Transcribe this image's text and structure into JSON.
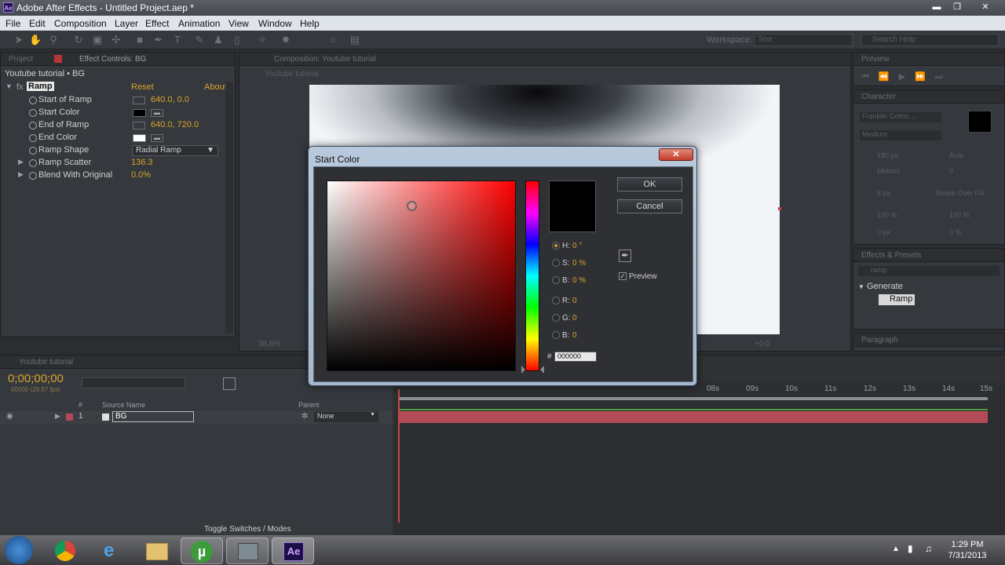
{
  "window": {
    "title": "Adobe After Effects - Untitled Project.aep *",
    "app_icon": "Ae"
  },
  "menu": [
    "File",
    "Edit",
    "Composition",
    "Layer",
    "Effect",
    "Animation",
    "View",
    "Window",
    "Help"
  ],
  "toolbar": {
    "workspace_label": "Workspace:",
    "workspace_value": "Text",
    "search_placeholder": "Search Help"
  },
  "effect_controls": {
    "tab_project": "Project",
    "tab_effect": "Effect Controls: BG",
    "breadcrumb": "Youtube tutorial • BG",
    "effect_name": "Ramp",
    "reset": "Reset",
    "about": "About...",
    "props": [
      {
        "label": "Start of Ramp",
        "value": "640.0, 0.0",
        "kind": "point"
      },
      {
        "label": "Start Color",
        "value": "",
        "kind": "color",
        "color": "#000000"
      },
      {
        "label": "End of Ramp",
        "value": "640.0, 720.0",
        "kind": "point"
      },
      {
        "label": "End Color",
        "value": "",
        "kind": "color",
        "color": "#ffffff"
      },
      {
        "label": "Ramp Shape",
        "value": "Radial Ramp",
        "kind": "select"
      },
      {
        "label": "Ramp Scatter",
        "value": "136.3",
        "kind": "number"
      },
      {
        "label": "Blend With Original",
        "value": "0.0%",
        "kind": "number"
      }
    ]
  },
  "composition": {
    "tab": "Composition: Youtube tutorial",
    "subtab": "Youtube tutorial",
    "zoom": "38.8%",
    "exposure": "+0.0"
  },
  "right_panels": {
    "preview_tab": "Preview",
    "character_tab": "Character",
    "font": "Franklin Gothic ...",
    "style": "Medium",
    "size": "180 px",
    "leading": "Auto",
    "kerning": "Metrics",
    "tracking": "0",
    "stroke": "Stroke Over Fill",
    "stroke_size": "5 px",
    "vscale": "100 %",
    "hscale": "100 %",
    "baseline": "0 px",
    "tsume": "0 %",
    "effects_tab": "Effects & Presets",
    "effects_search": "ramp",
    "category": "Generate",
    "effect_item": "Ramp",
    "paragraph_tab": "Paragraph"
  },
  "timeline": {
    "tab": "Youtube tutorial",
    "timecode": "0;00;00;00",
    "frames": "00000 (29.97 fps)",
    "col_num": "#",
    "col_source": "Source Name",
    "col_parent": "Parent",
    "layer_num": "1",
    "layer_name": "BG",
    "parent_value": "None",
    "footer": "Toggle Switches / Modes",
    "ruler": [
      "08s",
      "09s",
      "10s",
      "11s",
      "12s",
      "13s",
      "14s",
      "15s"
    ]
  },
  "dialog": {
    "title": "Start Color",
    "ok": "OK",
    "cancel": "Cancel",
    "preview": "Preview",
    "hsb": [
      {
        "label": "H:",
        "value": "0 °"
      },
      {
        "label": "S:",
        "value": "0 %"
      },
      {
        "label": "B:",
        "value": "0 %"
      }
    ],
    "rgb": [
      {
        "label": "R:",
        "value": "0"
      },
      {
        "label": "G:",
        "value": "0"
      },
      {
        "label": "B:",
        "value": "0"
      }
    ],
    "hex_prefix": "#",
    "hex": "000000",
    "current_color": "#000000",
    "accent": "#d7a52a"
  },
  "taskbar": {
    "time": "1:29 PM",
    "date": "7/31/2013"
  }
}
